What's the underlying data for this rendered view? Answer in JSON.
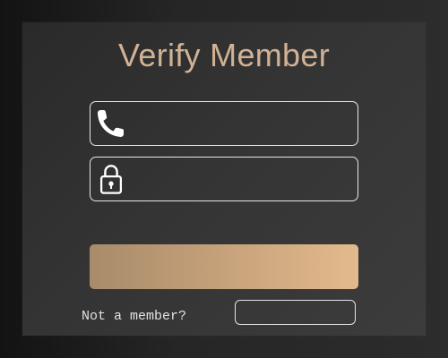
{
  "header": {
    "title": "Verify Member"
  },
  "form": {
    "phone": {
      "icon": "phone-icon",
      "value": "",
      "placeholder": ""
    },
    "password": {
      "icon": "lock-icon",
      "value": "",
      "placeholder": ""
    },
    "submit_label": ""
  },
  "footer": {
    "prompt": "Not a member?",
    "signup_label": ""
  },
  "colors": {
    "title": "#d2b295",
    "button_gradient_start": "#a88b6a",
    "button_gradient_end": "#e3ba8c",
    "field_border": "#e8e8e8",
    "card_background": "#333333"
  }
}
